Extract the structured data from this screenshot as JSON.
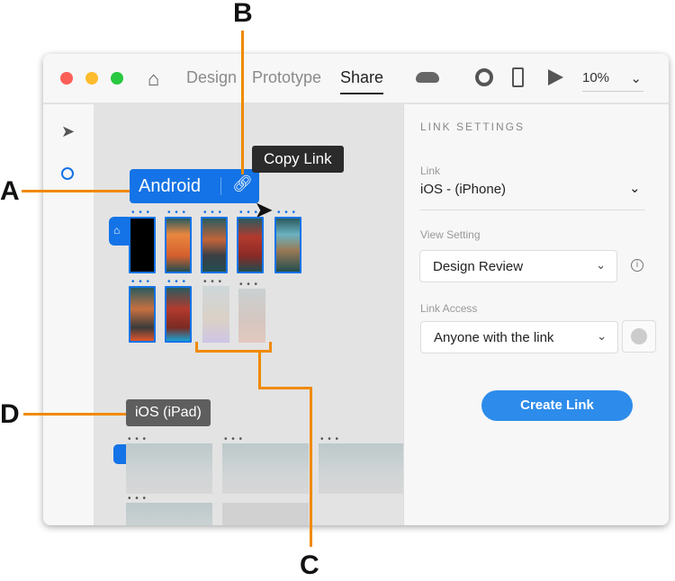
{
  "titlebar": {
    "tabs": [
      "Design",
      "Prototype",
      "Share"
    ],
    "active_tab": "Share",
    "zoom": "10%"
  },
  "canvas": {
    "android_label": "Android",
    "tooltip": "Copy Link",
    "ipad_label": "iOS (iPad)",
    "more": "• • •"
  },
  "panel": {
    "heading": "LINK SETTINGS",
    "link_label": "Link",
    "link_value": "iOS - (iPhone)",
    "view_label": "View Setting",
    "view_value": "Design Review",
    "access_label": "Link Access",
    "access_value": "Anyone with the link",
    "create": "Create Link"
  },
  "callouts": {
    "a": "A",
    "b": "B",
    "c": "C",
    "d": "D"
  },
  "colors": {
    "accent": "#1473e6",
    "button": "#2d8ceb",
    "callout": "#f08a00"
  }
}
